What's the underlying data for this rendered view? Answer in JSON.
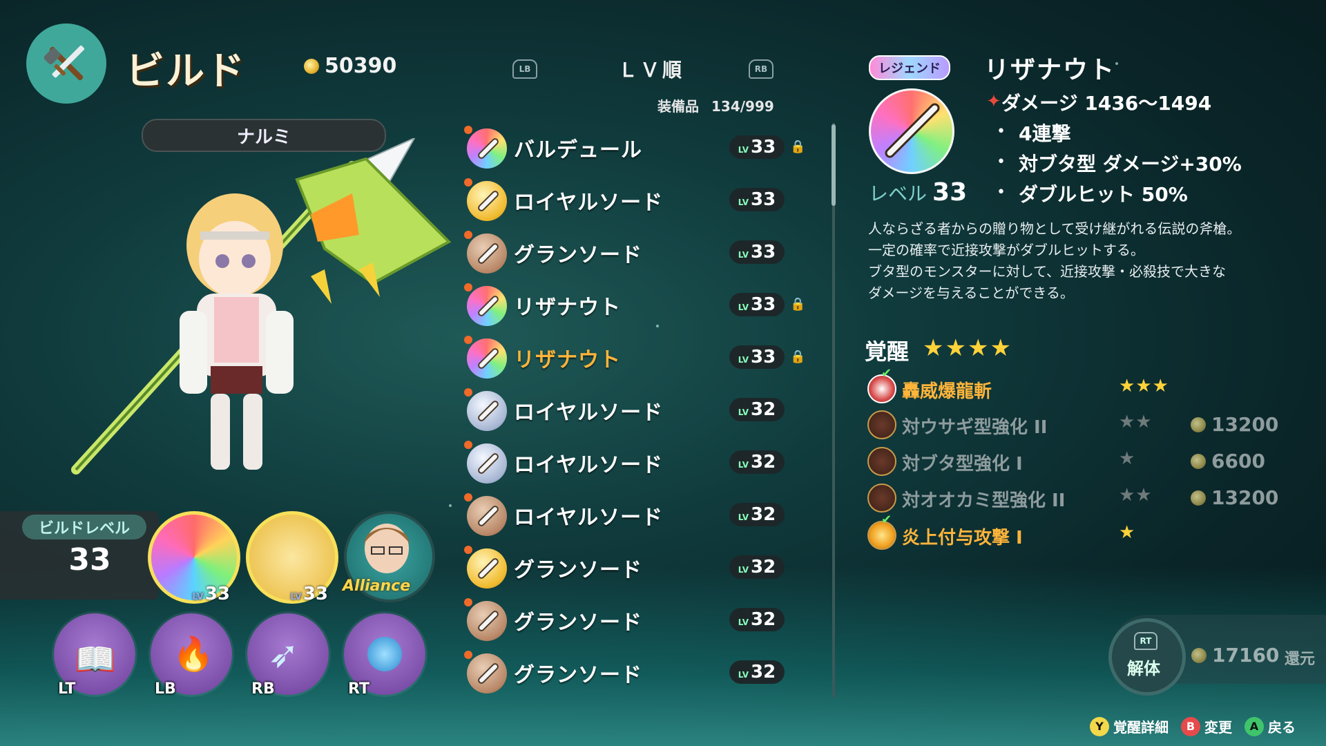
{
  "header": {
    "title": "ビルド",
    "coins": "50390"
  },
  "character": {
    "name": "ナルミ"
  },
  "build_level": {
    "label": "ビルドレベル",
    "value": "33"
  },
  "equipment_slots": [
    {
      "name": "weapon",
      "lv_label": "LV",
      "level": "33"
    },
    {
      "name": "armor",
      "lv_label": "LV",
      "level": "33"
    },
    {
      "name": "alliance",
      "label": "Alliance"
    }
  ],
  "skills": [
    {
      "key": "LT",
      "icon": "magic-book-icon"
    },
    {
      "key": "LB",
      "icon": "flame-book-icon"
    },
    {
      "key": "RB",
      "icon": "bow-icon"
    },
    {
      "key": "RT",
      "icon": "potion-icon"
    }
  ],
  "list_header": {
    "lb": "LB",
    "rb": "RB",
    "sort": "ＬＶ順",
    "equip_label": "装備品",
    "equip_count": "134/999"
  },
  "items": [
    {
      "name": "バルデュール",
      "lv_label": "LV",
      "level": "33",
      "locked": true,
      "icon": "rainbow"
    },
    {
      "name": "ロイヤルソード",
      "lv_label": "LV",
      "level": "33",
      "locked": false,
      "icon": "gold"
    },
    {
      "name": "グランソード",
      "lv_label": "LV",
      "level": "33",
      "locked": false,
      "icon": "bronze"
    },
    {
      "name": "リザナウト",
      "lv_label": "LV",
      "level": "33",
      "locked": true,
      "icon": "rainbow"
    },
    {
      "name": "リザナウト",
      "lv_label": "LV",
      "level": "33",
      "locked": true,
      "icon": "rainbow",
      "selected": true
    },
    {
      "name": "ロイヤルソード",
      "lv_label": "LV",
      "level": "32",
      "locked": false,
      "icon": "silver"
    },
    {
      "name": "ロイヤルソード",
      "lv_label": "LV",
      "level": "32",
      "locked": false,
      "icon": "silver"
    },
    {
      "name": "ロイヤルソード",
      "lv_label": "LV",
      "level": "32",
      "locked": false,
      "icon": "bronze"
    },
    {
      "name": "グランソード",
      "lv_label": "LV",
      "level": "32",
      "locked": false,
      "icon": "gold"
    },
    {
      "name": "グランソード",
      "lv_label": "LV",
      "level": "32",
      "locked": false,
      "icon": "bronze"
    },
    {
      "name": "グランソード",
      "lv_label": "LV",
      "level": "32",
      "locked": false,
      "icon": "bronze"
    }
  ],
  "detail": {
    "rarity": "レジェンド",
    "name": "リザナウト",
    "level_label": "レベル",
    "level": "33",
    "stats": [
      "ダメージ 1436～1494",
      "4連撃",
      "対ブタ型 ダメージ+30%",
      "ダブルヒット 50%"
    ],
    "description": [
      "人ならざる者からの贈り物として受け継がれる伝説の斧槍。",
      "一定の確率で近接攻撃がダブルヒットする。",
      "ブタ型のモンスターに対して、近接攻撃・必殺技で大きな",
      "ダメージを与えることができる。"
    ],
    "awakening_title": "覚醒",
    "awakening_stars": "★★★★",
    "abilities": [
      {
        "name": "轟威爆龍斬",
        "stars": "★★★",
        "cost": "",
        "active": true,
        "checked": true,
        "icon": "dragon-slash-icon"
      },
      {
        "name": "対ウサギ型強化 II",
        "stars": "★★",
        "cost": "13200",
        "active": false,
        "checked": false,
        "icon": "rabbit-icon"
      },
      {
        "name": "対ブタ型強化 I",
        "stars": "★",
        "cost": "6600",
        "active": false,
        "checked": false,
        "icon": "pig-icon"
      },
      {
        "name": "対オオカミ型強化 II",
        "stars": "★★",
        "cost": "13200",
        "active": false,
        "checked": false,
        "icon": "wolf-icon"
      },
      {
        "name": "炎上付与攻撃 I",
        "stars": "★",
        "cost": "",
        "active": true,
        "checked": true,
        "icon": "fire-icon"
      }
    ]
  },
  "dismantle": {
    "key": "RT",
    "label": "解体",
    "refund": "17160",
    "refund_label": "還元"
  },
  "hints": [
    {
      "button": "Y",
      "label": "覚醒詳細"
    },
    {
      "button": "B",
      "label": "変更"
    },
    {
      "button": "A",
      "label": "戻る"
    }
  ],
  "colors": {
    "accent_orange": "#ffb43a",
    "star_yellow": "#ffd23a",
    "badge_orange": "#f06a2a"
  }
}
